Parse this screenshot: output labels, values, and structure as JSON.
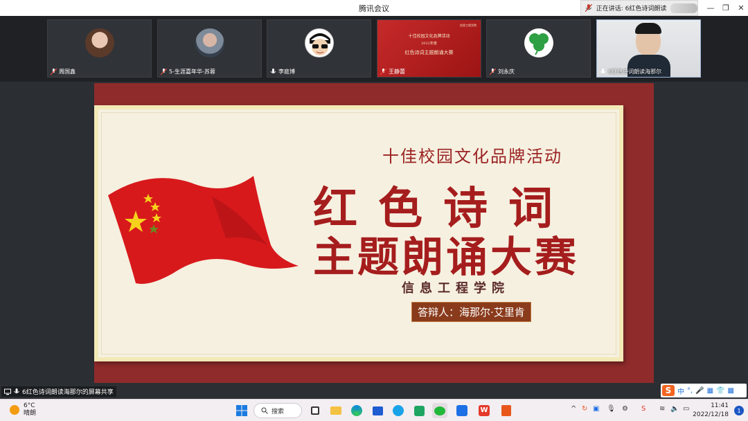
{
  "window": {
    "title": "腾讯会议",
    "speaking_prefix": "正在讲话:",
    "speaking_name": "6红色诗词朗读..."
  },
  "participants": [
    {
      "name": "周国鑫",
      "muted": true
    },
    {
      "name": "5-生涯嘉年华-苏蓉",
      "muted": true
    },
    {
      "name": "李庭博",
      "muted": false
    },
    {
      "name": "王静蕾",
      "muted": true
    },
    {
      "name": "刘永庆",
      "muted": true
    },
    {
      "name": "6红色诗词朗读海那尔",
      "muted": false
    }
  ],
  "tile4_thumbnail": {
    "header_text": "信息工程学院",
    "line1": "十佳校园文化品牌活动",
    "line2": "2022年度",
    "line3": "红色诗词主题朗诵大赛"
  },
  "slide": {
    "subtitle": "十佳校园文化品牌活动",
    "title_line1": "红色诗词",
    "title_line2": "主题朗诵大赛",
    "college": "信息工程学院",
    "presenter": "答辩人：海那尔·艾里肯"
  },
  "share": {
    "label": "6红色诗词朗读海那尔的屏幕共享"
  },
  "ime": {
    "mode": "中"
  },
  "taskbar": {
    "temperature": "6°C",
    "weather": "晴朗",
    "search_label": "搜索",
    "time": "11:41",
    "date": "2022/12/18",
    "notification_count": "1"
  },
  "colors": {
    "slide_border": "#8f2b2b",
    "slide_text": "#a51d1d",
    "flag": "#d7191c",
    "presenter_box": "#8a3b1c"
  }
}
